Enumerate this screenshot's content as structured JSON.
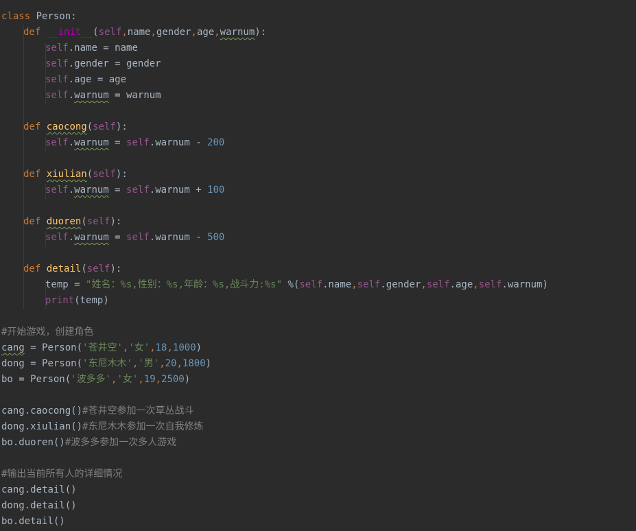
{
  "editor": {
    "colors": {
      "background": "#2b2b2b",
      "text": "#a9b7c6",
      "keyword": "#cc7832",
      "function_name": "#ffc66d",
      "dunder": "#b200b2",
      "self": "#94558d",
      "number": "#6897bb",
      "string": "#6a8759",
      "comment": "#808080"
    },
    "tokens": {
      "kw_class": "class",
      "kw_def": "def",
      "kw_self": "self",
      "kw_print": "print",
      "class_name": "Person",
      "init_name": "__init__",
      "p_name": "name",
      "p_gender": "gender",
      "p_age": "age",
      "p_warnum": "warnum",
      "m_caocong": "caocong",
      "m_xiulian": "xiulian",
      "m_duoren": "duoren",
      "m_detail": "detail",
      "v_temp": "temp",
      "v_cang": "cang",
      "v_dong": "dong",
      "v_bo": "bo",
      "n_200": "200",
      "n_100": "100",
      "n_500": "500",
      "n_18": "18",
      "n_1000": "1000",
      "n_20": "20",
      "n_1800": "1800",
      "n_19": "19",
      "n_2500": "2500",
      "s_format": "\"姓名：%s,性别：%s,年龄：%s,战斗力:%s\"",
      "s_cang_name": "'苍井空'",
      "s_dong_name": "'东尼木木'",
      "s_bo_name": "'波多多'",
      "s_female": "'女'",
      "s_male": "'男'",
      "c_start": "#开始游戏，创建角色",
      "c_caocong": "#苍井空参加一次草丛战斗",
      "c_xiulian": "#东尼木木参加一次自我修炼",
      "c_duoren": "#波多多参加一次多人游戏",
      "c_output": "#输出当前所有人的详细情况"
    }
  }
}
